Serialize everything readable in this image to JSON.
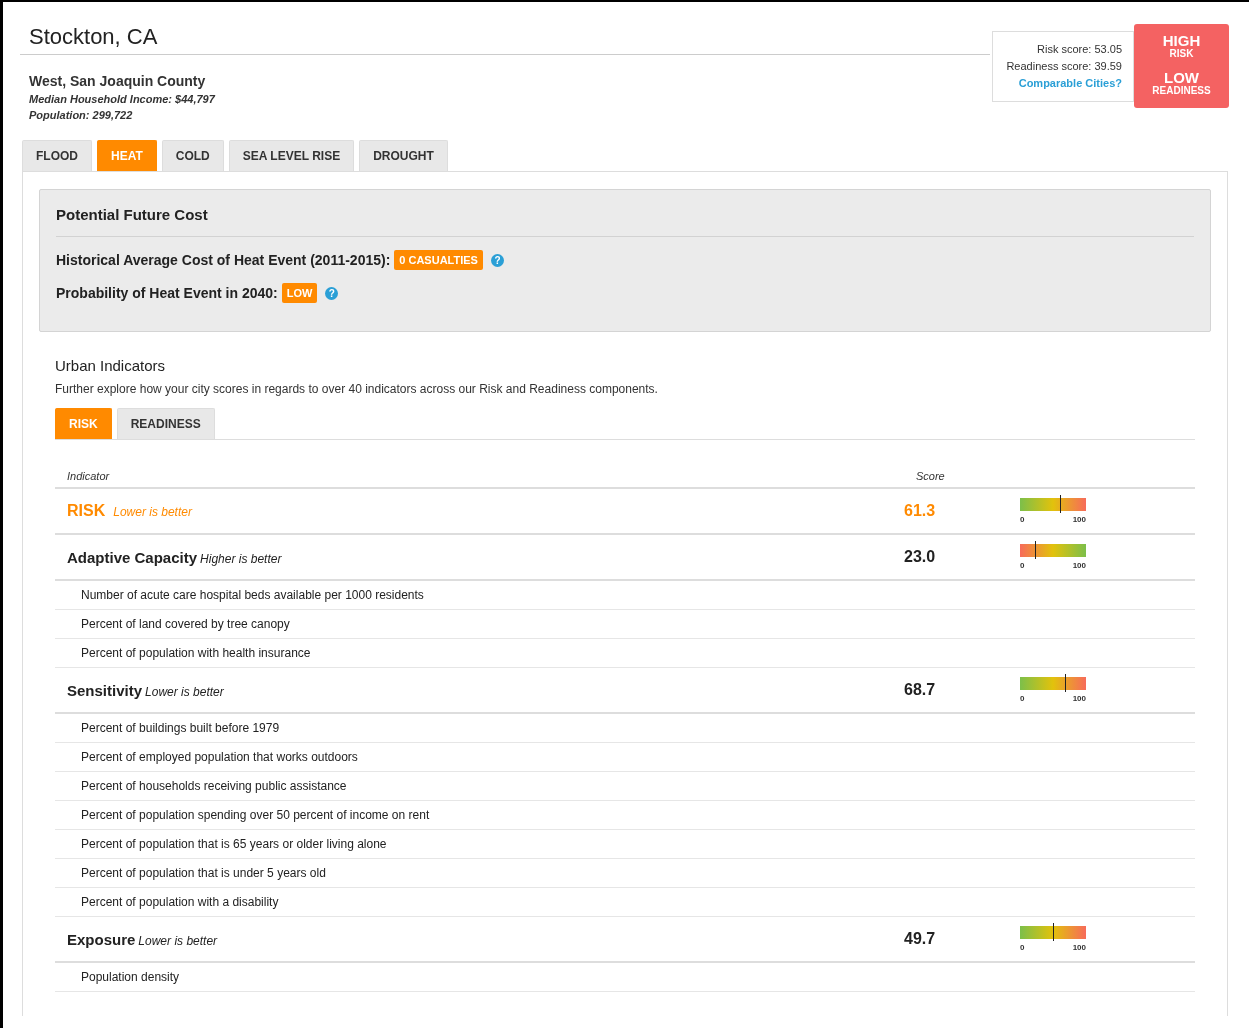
{
  "city": {
    "title": "Stockton, CA",
    "region": "West, San Joaquin County",
    "income": "Median Household Income: $44,797",
    "population": "Population: 299,722"
  },
  "scores": {
    "risk": "Risk score: 53.05",
    "readiness": "Readiness score: 39.59",
    "link": "Comparable Cities?"
  },
  "rating": {
    "risk_level": "HIGH",
    "risk_label": "RISK",
    "readiness_level": "LOW",
    "readiness_label": "READINESS"
  },
  "hazard_tabs": [
    {
      "label": "FLOOD",
      "selected": false
    },
    {
      "label": "HEAT",
      "selected": true
    },
    {
      "label": "COLD",
      "selected": false
    },
    {
      "label": "SEA LEVEL RISE",
      "selected": false
    },
    {
      "label": "DROUGHT",
      "selected": false
    }
  ],
  "cost_panel": {
    "title": "Potential Future Cost",
    "facts": [
      {
        "label": "Historical Average Cost of Heat Event (2011-2015):",
        "badge": "0 CASUALTIES",
        "help": "?"
      },
      {
        "label": "Probability of Heat Event in 2040:",
        "badge": "LOW",
        "help": "?"
      }
    ]
  },
  "urban": {
    "title": "Urban Indicators",
    "description": "Further explore how your city scores in regards to over 40 indicators across our Risk and Readiness components.",
    "tabs": [
      {
        "label": "RISK",
        "selected": true
      },
      {
        "label": "READINESS",
        "selected": false
      }
    ],
    "columns": [
      "Indicator",
      "Score"
    ],
    "rows": [
      {
        "kind": "total",
        "name": "RISK",
        "note": "Lower is better",
        "score": "61.3",
        "level": 0.613,
        "reversed": false,
        "min": "0",
        "max": "100"
      },
      {
        "kind": "group",
        "name": "Adaptive Capacity",
        "note": "Higher is better",
        "score": "23.0",
        "level": 0.23,
        "reversed": true,
        "min": "0",
        "max": "100"
      },
      {
        "kind": "indicator",
        "name": "Number of acute care hospital beds available per 1000 residents"
      },
      {
        "kind": "indicator",
        "name": "Percent of land covered by tree canopy"
      },
      {
        "kind": "indicator",
        "name": "Percent of population with health insurance"
      },
      {
        "kind": "group",
        "name": "Sensitivity",
        "note": "Lower is better",
        "score": "68.7",
        "level": 0.687,
        "reversed": false,
        "min": "0",
        "max": "100"
      },
      {
        "kind": "indicator",
        "name": "Percent of buildings built before 1979"
      },
      {
        "kind": "indicator",
        "name": "Percent of employed population that works outdoors"
      },
      {
        "kind": "indicator",
        "name": "Percent of households receiving public assistance"
      },
      {
        "kind": "indicator",
        "name": "Percent of population spending over 50 percent of income on rent"
      },
      {
        "kind": "indicator",
        "name": "Percent of population that is 65 years or older living alone"
      },
      {
        "kind": "indicator",
        "name": "Percent of population that is under 5 years old"
      },
      {
        "kind": "indicator",
        "name": "Percent of population with a disability"
      },
      {
        "kind": "group",
        "name": "Exposure",
        "note": "Lower is better",
        "score": "49.7",
        "level": 0.497,
        "reversed": false,
        "min": "0",
        "max": "100"
      },
      {
        "kind": "indicator",
        "name": "Population density"
      }
    ]
  }
}
